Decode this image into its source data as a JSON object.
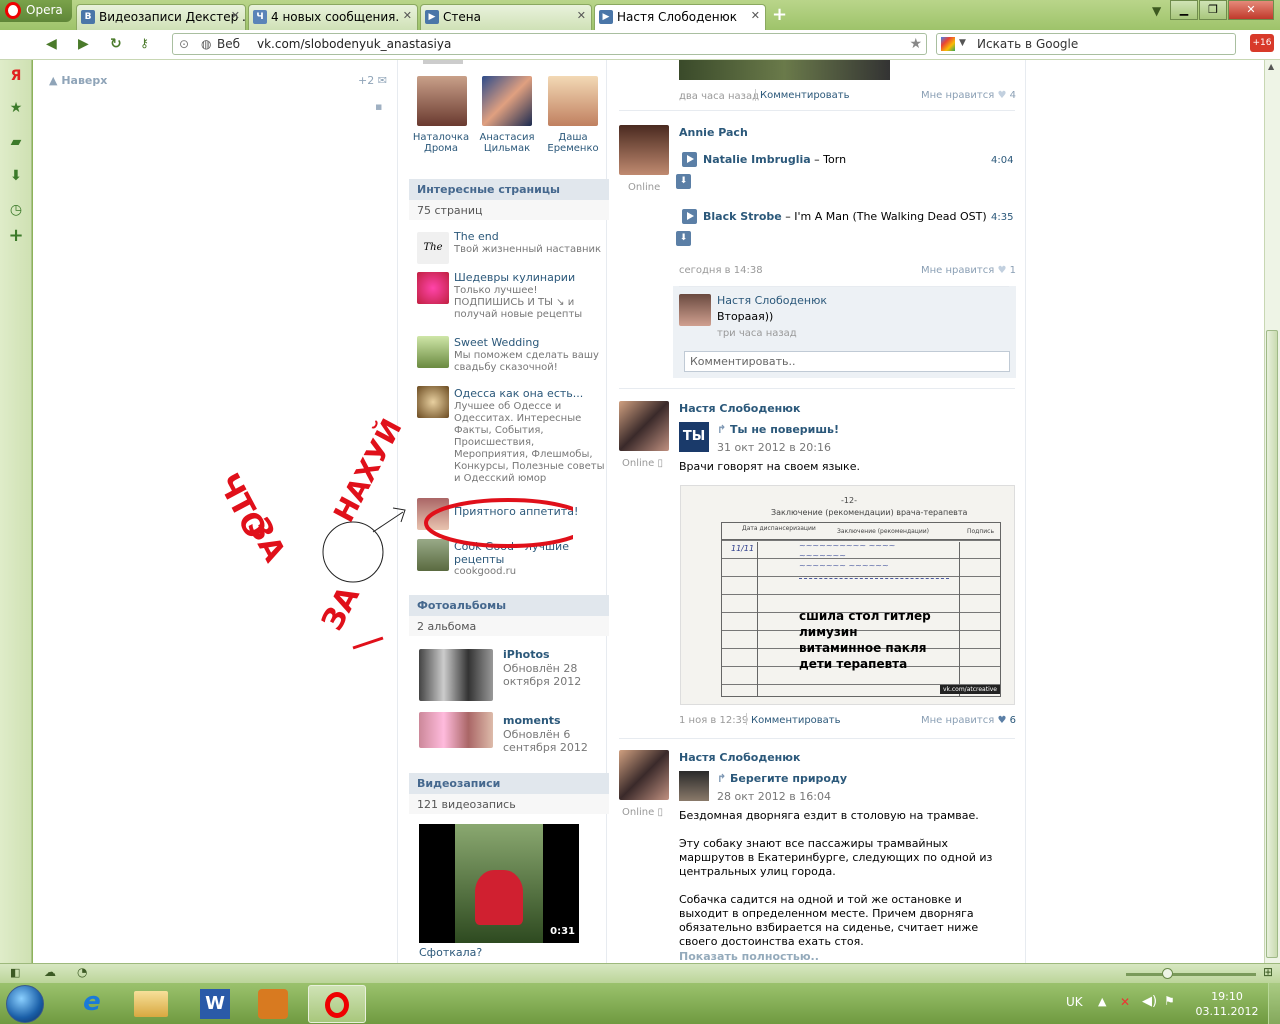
{
  "browser": {
    "menu_label": "Opera",
    "tabs": [
      {
        "label": "Видеозаписи Декстер ...",
        "icon": "В"
      },
      {
        "label": "4 новых сообщения.",
        "icon": "Ч"
      },
      {
        "label": "Стена",
        "icon": "▶"
      },
      {
        "label": "Настя Слободенюк",
        "icon": "▶"
      }
    ],
    "address_prefix": "Веб",
    "url": "vk.com/slobodenyuk_anastasiya",
    "search_placeholder": "Искать в Google",
    "badge": "+16"
  },
  "status": {
    "lang": "UK",
    "time": "19:10",
    "date": "03.11.2012"
  },
  "left": {
    "back_to_top": "Наверх",
    "plus2": "+2"
  },
  "friends": [
    {
      "first": "Наталочка",
      "last": "Дрома"
    },
    {
      "first": "Анастасия",
      "last": "Цильмак"
    },
    {
      "first": "Даша",
      "last": "Еременко"
    }
  ],
  "pages": {
    "title": "Интересные страницы",
    "count": "75 страниц",
    "items": [
      {
        "name": "The end",
        "desc": [
          "Твой жизненный наставник"
        ]
      },
      {
        "name": "Шедевры кулинарии",
        "desc": [
          "Только лучшее!",
          "ПОДПИШИСЬ И ТЫ ↘ и",
          "получай новые рецепты"
        ]
      },
      {
        "name": "Sweet Wedding",
        "desc": [
          "Мы поможем сделать вашу",
          "свадьбу сказочной!"
        ]
      },
      {
        "name": "Одесса как она есть...",
        "desc": [
          "Лучшее об Одессе и",
          "Одесситах. Интересные",
          "Факты, События,",
          "Происшествия,",
          "Мероприятия, Флешмобы,",
          "Конкурсы, Полезные советы",
          "и Одесский юмор"
        ]
      },
      {
        "name": "Приятного аппетита!",
        "desc": []
      },
      {
        "name": "Cook Good - лучшие рецепты",
        "desc": [
          "cookgood.ru"
        ]
      }
    ]
  },
  "albums": {
    "title": "Фотоальбомы",
    "count": "2 альбома",
    "items": [
      {
        "name": "iPhotos",
        "updated": [
          "Обновлён 28",
          "октября 2012"
        ]
      },
      {
        "name": "moments",
        "updated": [
          "Обновлён 6",
          "сентября 2012"
        ]
      }
    ]
  },
  "videos": {
    "title": "Видеозаписи",
    "count": "121 видеозапись",
    "duration": "0:31",
    "caption": "Сфоткала?"
  },
  "feed": {
    "p0": {
      "time": "два часа назад",
      "comment": "Комментировать",
      "like": "Мне нравится",
      "likes": "4"
    },
    "p1": {
      "author": "Annie Pach",
      "online": "Online",
      "tracks": [
        {
          "artist": "Natalie Imbruglia",
          "title": "Torn",
          "dur": "4:04"
        },
        {
          "artist": "Black Strobe",
          "title": "I'm A Man (The Walking Dead OST)",
          "dur": "4:35"
        }
      ],
      "time": "сегодня в 14:38",
      "like": "Мне нравится",
      "likes": "1",
      "reply_author": "Настя Слободенюк",
      "reply_text": "Втораая))",
      "reply_time": "три часа назад",
      "comment_placeholder": "Комментировать.."
    },
    "p2": {
      "author": "Настя Слободенюк",
      "online": "Online",
      "repost_name": "Ты не поверишь!",
      "repost_date": "31 окт 2012 в 20:16",
      "text": "Врачи говорят на своем языке.",
      "doc_title": "-12-",
      "doc_header": "Заключение (рекомендации) врача-терапевта",
      "doc_cols": [
        "Дата диспансеризации",
        "Заключение (рекомендации)",
        "Подпись"
      ],
      "doc_lines": [
        "сшила стол гитлер",
        "лимузин",
        "витаминное пакля",
        "дети терапевта"
      ],
      "watermark": "vk.com/atcreative",
      "time": "1 ноя в 12:39",
      "comment": "Комментировать",
      "like": "Мне нравится",
      "likes": "6"
    },
    "p3": {
      "author": "Настя Слободенюк",
      "online": "Online",
      "repost_name": "Берегите природу",
      "repost_date": "28 окт 2012 в 16:04",
      "paragraphs": [
        "Бездомная дворняга ездит в столовую на трамвае.",
        "Эту собаку знают все пассажиры трамвайных маршрутов в Екатеринбурге, следующих по одной из центральных улиц города.",
        "Собачка садится на одной и той же остановке и выходит в определенном месте. Причем дворняга обязательно взбирается на сиденье, считает ниже своего достоинства ехать стоя."
      ],
      "more": "Показать полностью.."
    }
  },
  "annotation": {
    "lines": [
      "ЧТО",
      "ЗА",
      "НАХУЙ",
      "ЗА"
    ]
  },
  "colors": {
    "vk_link": "#2b587a",
    "vk_header_bg": "#e1e7ed",
    "annotation_red": "#e0101a",
    "opera_green": "#9ec36a"
  }
}
